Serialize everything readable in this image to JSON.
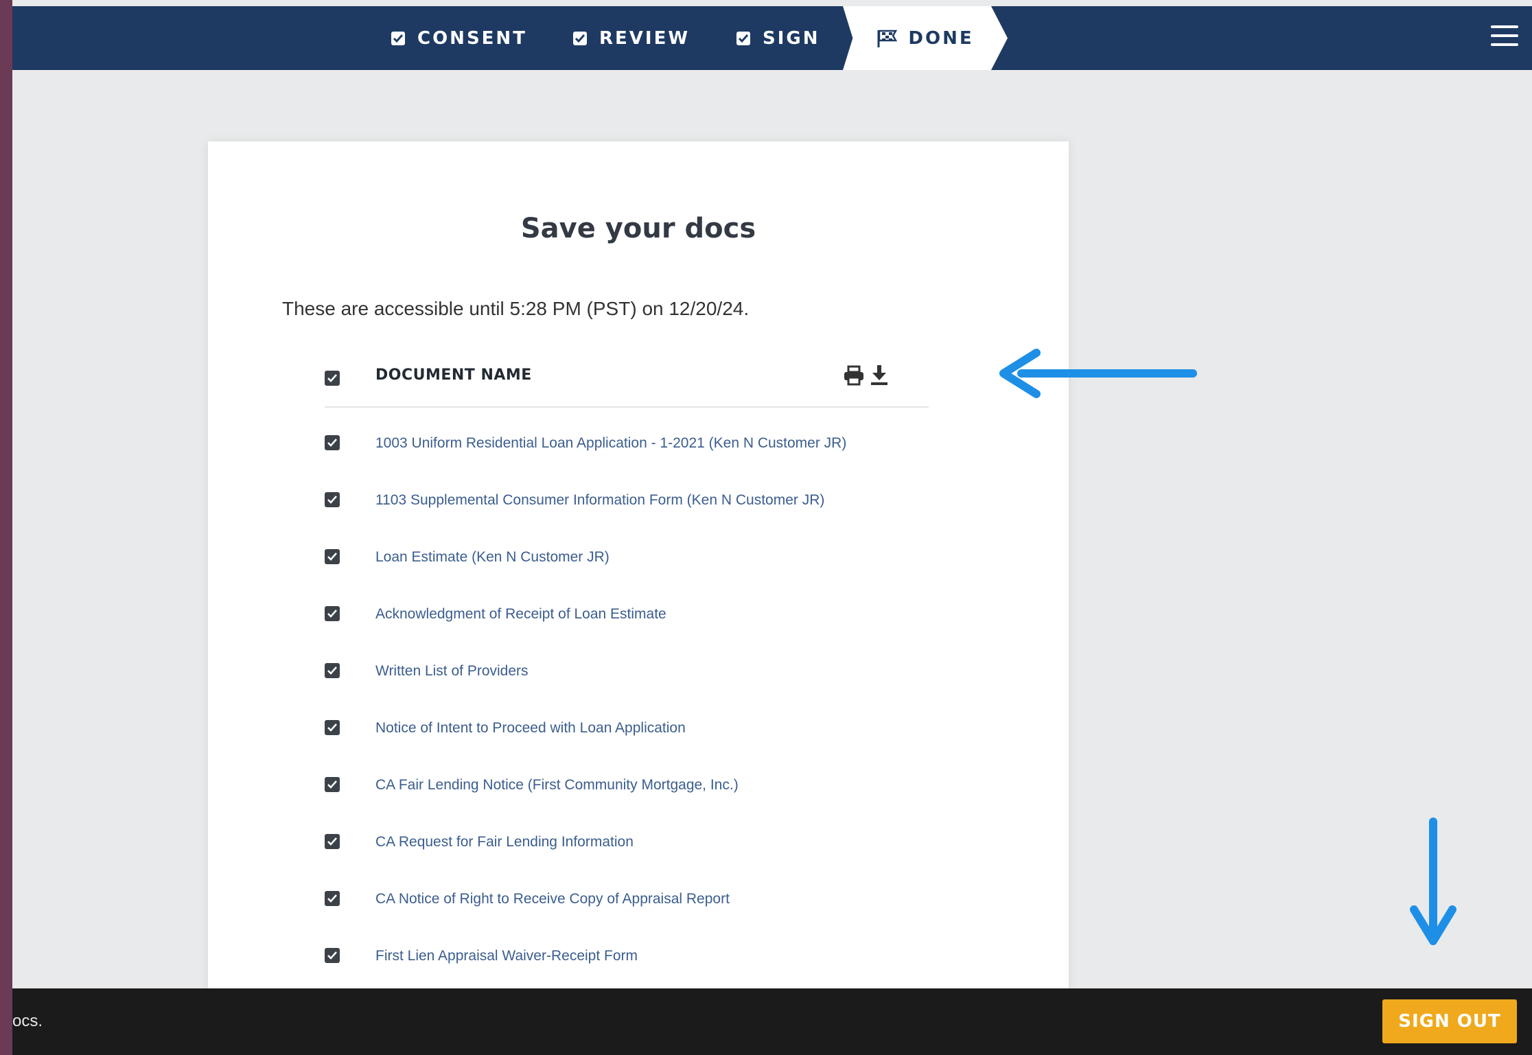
{
  "nav": {
    "steps": [
      {
        "label": "CONSENT",
        "icon": "checkbox-icon"
      },
      {
        "label": "REVIEW",
        "icon": "checkbox-icon"
      },
      {
        "label": "SIGN",
        "icon": "checkbox-icon"
      },
      {
        "label": "DONE",
        "icon": "flag-icon",
        "active": true
      }
    ],
    "menu_icon": "hamburger-icon"
  },
  "card": {
    "title": "Save your docs",
    "access_text": "These are accessible until 5:28 PM (PST) on 12/20/24.",
    "table": {
      "header": "DOCUMENT NAME",
      "actions": [
        "print-icon",
        "download-icon"
      ],
      "rows": [
        "1003 Uniform Residential Loan Application - 1-2021 (Ken N Customer JR)",
        "1103 Supplemental Consumer Information Form (Ken N Customer JR)",
        "Loan Estimate (Ken N Customer JR)",
        "Acknowledgment of Receipt of Loan Estimate",
        "Written List of Providers",
        "Notice of Intent to Proceed with Loan Application",
        "CA Fair Lending Notice (First Community Mortgage, Inc.)",
        "CA Request for Fair Lending Information",
        "CA Notice of Right to Receive Copy of Appraisal Report",
        "First Lien Appraisal Waiver-Receipt Form"
      ]
    }
  },
  "footer": {
    "text": "ocs.",
    "signout_label": "SIGN OUT"
  },
  "colors": {
    "nav_bg": "#1e3a63",
    "link": "#3b5d8f",
    "signout": "#f0a91c",
    "annotation_arrow": "#1e8fe6"
  }
}
